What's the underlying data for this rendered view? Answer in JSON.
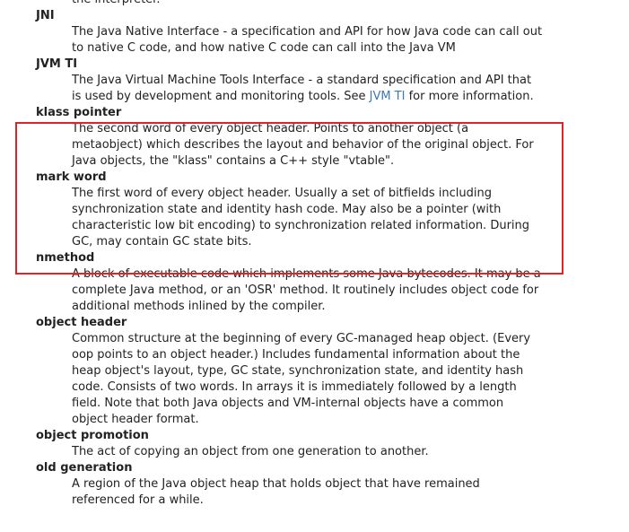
{
  "glossary": {
    "partial_top": {
      "definition": "the interpreter."
    },
    "entries": [
      {
        "term": "JNI",
        "definition": "The Java Native Interface - a specification and API for how Java code can call out to native C code, and how native C code can call into the Java VM"
      },
      {
        "term": "JVM TI",
        "definition_before_link": "The Java Virtual Machine Tools Interface - a standard specification and API that is used by development and monitoring tools. See ",
        "link_text": "JVM TI",
        "definition_after_link": " for more information."
      },
      {
        "term": "klass pointer",
        "definition": "The second word of every object header. Points to another object (a metaobject) which describes the layout and behavior of the original object. For Java objects, the \"klass\" contains a C++ style \"vtable\"."
      },
      {
        "term": "mark word",
        "definition": "The first word of every object header. Usually a set of bitfields including synchronization state and identity hash code. May also be a pointer (with characteristic low bit encoding) to synchronization related information. During GC, may contain GC state bits."
      },
      {
        "term": "nmethod",
        "definition": "A block of executable code which implements some Java bytecodes. It may be a complete Java method, or an 'OSR' method. It routinely includes object code for additional methods inlined by the compiler."
      },
      {
        "term": "object header",
        "definition": "Common structure at the beginning of every GC-managed heap object. (Every oop points to an object header.) Includes fundamental information about the heap object's layout, type, GC state, synchronization state, and identity hash code. Consists of two words. In arrays it is immediately followed by a length field. Note that both Java objects and VM-internal objects have a common object header format."
      },
      {
        "term": "object promotion",
        "definition": "The act of copying an object from one generation to another."
      },
      {
        "term": "old generation",
        "definition": "A region of the Java object heap that holds object that have remained referenced for a while."
      }
    ]
  },
  "colors": {
    "highlight_border": "#d9262a",
    "link": "#3b78b5",
    "text": "#222222"
  }
}
